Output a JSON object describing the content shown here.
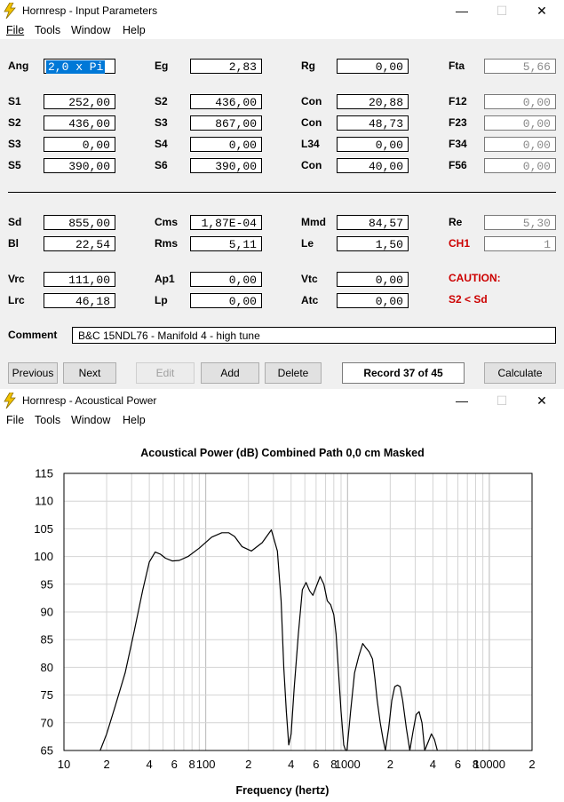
{
  "win1": {
    "title": "Hornresp - Input Parameters",
    "menu": [
      "File",
      "Tools",
      "Window",
      "Help"
    ],
    "row_labels": {
      "c1": [
        "Ang",
        "S1",
        "S2",
        "S3",
        "S5",
        "Sd",
        "Bl",
        "Vrc",
        "Lrc"
      ],
      "c2": [
        "Eg",
        "S2",
        "S3",
        "S4",
        "S6",
        "Cms",
        "Rms",
        "Ap1",
        "Lp"
      ],
      "c3": [
        "Rg",
        "Con",
        "Con",
        "L34",
        "Con",
        "Mmd",
        "Le",
        "Vtc",
        "Atc"
      ],
      "c4": [
        "Fta",
        "F12",
        "F23",
        "F34",
        "F56",
        "Re",
        "CH1"
      ]
    },
    "values": {
      "c1": [
        "2,0 x Pi",
        "252,00",
        "436,00",
        "0,00",
        "390,00",
        "855,00",
        "22,54",
        "111,00",
        "46,18"
      ],
      "c2": [
        "2,83",
        "436,00",
        "867,00",
        "0,00",
        "390,00",
        "1,87E-04",
        "5,11",
        "0,00",
        "0,00"
      ],
      "c3": [
        "0,00",
        "20,88",
        "48,73",
        "0,00",
        "40,00",
        "84,57",
        "1,50",
        "0,00",
        "0,00"
      ],
      "c4": [
        "5,66",
        "0,00",
        "0,00",
        "0,00",
        "0,00",
        "5,30",
        "1"
      ]
    },
    "caution": "CAUTION:",
    "caution_msg": "S2 < Sd",
    "comment_label": "Comment",
    "comment": "B&C 15NDL76 - Manifold 4 - high tune",
    "buttons": {
      "previous": "Previous",
      "next": "Next",
      "edit": "Edit",
      "add": "Add",
      "delete": "Delete",
      "record": "Record 37 of 45",
      "calculate": "Calculate"
    }
  },
  "win2": {
    "title": "Hornresp - Acoustical Power",
    "menu": [
      "File",
      "Tools",
      "Window",
      "Help"
    ]
  },
  "chart_data": {
    "type": "line",
    "title": "Acoustical Power (dB)   Combined   Path 0,0 cm   Masked",
    "xlabel": "Frequency (hertz)",
    "ylabel": "",
    "x_scale": "log",
    "xlim": [
      10,
      20000
    ],
    "ylim": [
      65,
      115
    ],
    "y_ticks": [
      65,
      70,
      75,
      80,
      85,
      90,
      95,
      100,
      105,
      110,
      115
    ],
    "x_tick_labels": [
      "10",
      "2",
      "4",
      "6",
      "8",
      "100",
      "2",
      "4",
      "6",
      "8",
      "1000",
      "2",
      "4",
      "6",
      "8",
      "10000",
      "2"
    ],
    "x_tick_values": [
      10,
      20,
      40,
      60,
      80,
      100,
      200,
      400,
      600,
      800,
      1000,
      2000,
      4000,
      6000,
      8000,
      10000,
      20000
    ],
    "grid": true,
    "series": [
      {
        "x": [
          18,
          20,
          23,
          27,
          31,
          36,
          40,
          44,
          48,
          52,
          58,
          65,
          75,
          90,
          110,
          130,
          145,
          160,
          180,
          210,
          250,
          290,
          320,
          340,
          355,
          370,
          385,
          400,
          420,
          450,
          480,
          510,
          540,
          570,
          600,
          640,
          680,
          720,
          760,
          800,
          830,
          860,
          900,
          940,
          970,
          990
        ],
        "y": [
          65,
          68,
          73,
          79,
          86,
          94,
          99,
          100.8,
          100.4,
          99.7,
          99.2,
          99.3,
          100,
          101.5,
          103.5,
          104.3,
          104.3,
          103.6,
          101.8,
          101,
          102.5,
          104.8,
          101,
          92,
          80,
          72,
          66,
          68,
          76,
          86,
          94,
          95.3,
          93.8,
          93,
          94.5,
          96.4,
          95,
          92,
          91.3,
          89.5,
          86,
          80,
          72,
          66,
          65,
          65
        ]
      },
      {
        "x": [
          990,
          1050,
          1120,
          1200,
          1280,
          1350,
          1420,
          1500,
          1560,
          1620,
          1700,
          1780,
          1850
        ],
        "y": [
          65,
          72,
          79,
          82,
          84.3,
          83.5,
          82.8,
          81.5,
          78,
          74,
          70,
          67,
          65
        ]
      },
      {
        "x": [
          1850,
          1950,
          2050,
          2150,
          2250,
          2350,
          2450,
          2600,
          2750
        ],
        "y": [
          65,
          69,
          74,
          76.5,
          76.8,
          76.5,
          74,
          69,
          65
        ]
      },
      {
        "x": [
          2750,
          2900,
          3050,
          3200,
          3350,
          3500
        ],
        "y": [
          65,
          68.5,
          71.5,
          72,
          70,
          65
        ]
      },
      {
        "x": [
          3500,
          3700,
          3900,
          4100,
          4300
        ],
        "y": [
          65,
          66.5,
          68,
          67,
          65
        ]
      }
    ]
  }
}
